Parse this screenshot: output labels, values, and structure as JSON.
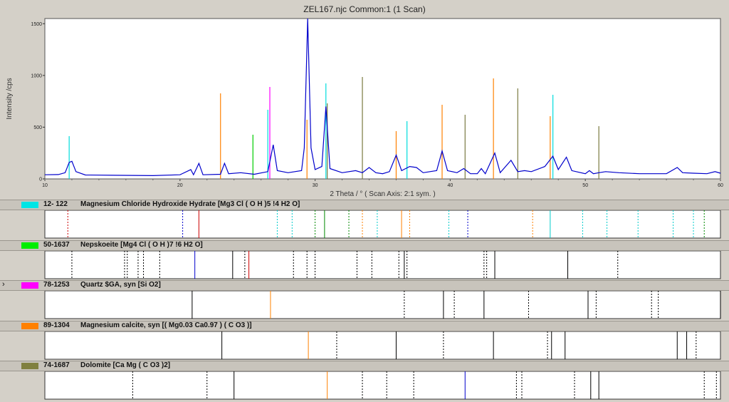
{
  "window": {
    "title": "ZEL167.njc Common:1 (1 Scan)"
  },
  "chart_data": {
    "type": "line",
    "title": "ZEL167.njc Common:1 (1 Scan)",
    "xlabel": "2 Theta / °   ( Scan Axis: 2:1 sym. )",
    "ylabel": "Intensity /cps",
    "xlim": [
      10,
      60
    ],
    "ylim": [
      0,
      1550
    ],
    "x_ticks": [
      10,
      20,
      30,
      40,
      50,
      60
    ],
    "y_ticks": [
      0,
      500,
      1000,
      1500
    ],
    "grid": false,
    "series": [
      {
        "color": "#0000cc",
        "points": [
          [
            10,
            40
          ],
          [
            11,
            42
          ],
          [
            11.5,
            60
          ],
          [
            11.8,
            160
          ],
          [
            12,
            170
          ],
          [
            12.3,
            70
          ],
          [
            13,
            38
          ],
          [
            15,
            35
          ],
          [
            18,
            32
          ],
          [
            20,
            40
          ],
          [
            20.8,
            90
          ],
          [
            21,
            40
          ],
          [
            21.4,
            150
          ],
          [
            21.7,
            40
          ],
          [
            23,
            45
          ],
          [
            23.3,
            150
          ],
          [
            23.6,
            50
          ],
          [
            24.5,
            60
          ],
          [
            25.5,
            45
          ],
          [
            26.5,
            70
          ],
          [
            26.9,
            330
          ],
          [
            27.2,
            80
          ],
          [
            28,
            60
          ],
          [
            29,
            80
          ],
          [
            29.2,
            300
          ],
          [
            29.45,
            1550
          ],
          [
            29.7,
            300
          ],
          [
            30,
            90
          ],
          [
            30.5,
            120
          ],
          [
            30.8,
            700
          ],
          [
            31.1,
            100
          ],
          [
            32,
            60
          ],
          [
            33,
            80
          ],
          [
            33.5,
            60
          ],
          [
            34,
            110
          ],
          [
            34.5,
            60
          ],
          [
            35,
            50
          ],
          [
            35.5,
            70
          ],
          [
            36,
            230
          ],
          [
            36.4,
            80
          ],
          [
            37,
            120
          ],
          [
            37.5,
            110
          ],
          [
            38,
            60
          ],
          [
            39,
            80
          ],
          [
            39.4,
            270
          ],
          [
            39.8,
            80
          ],
          [
            40.5,
            60
          ],
          [
            41,
            100
          ],
          [
            41.5,
            50
          ],
          [
            42,
            50
          ],
          [
            42.3,
            100
          ],
          [
            42.6,
            50
          ],
          [
            43.3,
            250
          ],
          [
            43.7,
            60
          ],
          [
            44.5,
            180
          ],
          [
            45,
            70
          ],
          [
            45.5,
            80
          ],
          [
            46,
            70
          ],
          [
            47,
            120
          ],
          [
            47.6,
            220
          ],
          [
            48,
            90
          ],
          [
            48.6,
            210
          ],
          [
            49,
            80
          ],
          [
            50,
            50
          ],
          [
            50.3,
            80
          ],
          [
            50.6,
            50
          ],
          [
            51,
            60
          ],
          [
            51.5,
            70
          ],
          [
            52.5,
            60
          ],
          [
            54,
            50
          ],
          [
            56,
            50
          ],
          [
            56.8,
            110
          ],
          [
            57.2,
            60
          ],
          [
            58,
            55
          ],
          [
            59,
            50
          ],
          [
            59.6,
            70
          ],
          [
            60,
            55
          ]
        ]
      }
    ],
    "overlay_sticks": [
      {
        "color": "#00dddd",
        "x": [
          11.8,
          26.5,
          30.8,
          36.8,
          47.6
        ]
      },
      {
        "color": "#ff8000",
        "x": [
          29.4,
          23.0,
          36.0,
          39.4,
          43.2,
          47.4
        ]
      },
      {
        "color": "#7a7a40",
        "x": [
          30.9,
          33.5,
          41.1,
          45.0,
          51.0
        ]
      },
      {
        "color": "#ff00ff",
        "x": [
          26.65
        ]
      },
      {
        "color": "#00cc00",
        "x": [
          25.4
        ]
      }
    ]
  },
  "phases": [
    {
      "code": "12- 122",
      "name": "Magnesium Chloride Hydroxide Hydrate  [Mg3 Cl ( O H )5 !4 H2 O]",
      "color": "#00e5e5",
      "selected": false,
      "lines": [
        {
          "x": 11.7,
          "color": "#cc0000",
          "style": "dashed"
        },
        {
          "x": 20.2,
          "color": "#0000cc",
          "style": "dashed"
        },
        {
          "x": 21.4,
          "color": "#cc0000",
          "style": "solid"
        },
        {
          "x": 27.2,
          "color": "#00cccc",
          "style": "dashed"
        },
        {
          "x": 28.3,
          "color": "#00cccc",
          "style": "dashed"
        },
        {
          "x": 30.0,
          "color": "#008800",
          "style": "dashed"
        },
        {
          "x": 30.7,
          "color": "#008800",
          "style": "solid"
        },
        {
          "x": 32.5,
          "color": "#008800",
          "style": "dashed"
        },
        {
          "x": 33.5,
          "color": "#ff8000",
          "style": "dashed"
        },
        {
          "x": 34.6,
          "color": "#00cccc",
          "style": "dashed"
        },
        {
          "x": 36.4,
          "color": "#ff8000",
          "style": "solid"
        },
        {
          "x": 37.0,
          "color": "#ff8000",
          "style": "dashed"
        },
        {
          "x": 39.9,
          "color": "#00cccc",
          "style": "dashed"
        },
        {
          "x": 41.3,
          "color": "#0000cc",
          "style": "dashed"
        },
        {
          "x": 46.1,
          "color": "#ff8000",
          "style": "dashed"
        },
        {
          "x": 47.4,
          "color": "#00cccc",
          "style": "solid"
        },
        {
          "x": 49.8,
          "color": "#00cccc",
          "style": "dashed"
        },
        {
          "x": 51.6,
          "color": "#00cccc",
          "style": "dashed"
        },
        {
          "x": 53.9,
          "color": "#00cccc",
          "style": "dashed"
        },
        {
          "x": 56.5,
          "color": "#00cccc",
          "style": "dashed"
        },
        {
          "x": 58.0,
          "color": "#00cccc",
          "style": "dashed"
        },
        {
          "x": 58.8,
          "color": "#008800",
          "style": "dashed"
        }
      ]
    },
    {
      "code": "50-1637",
      "name": "Nepskoeite  [Mg4 Cl ( O H )7 !6 H2 O]",
      "color": "#00ee00",
      "selected": false,
      "lines": [
        {
          "x": 12.0,
          "color": "#000000",
          "style": "dashed"
        },
        {
          "x": 15.9,
          "color": "#000000",
          "style": "dashed"
        },
        {
          "x": 16.1,
          "color": "#000000",
          "style": "dashed"
        },
        {
          "x": 16.9,
          "color": "#000000",
          "style": "dashed"
        },
        {
          "x": 17.3,
          "color": "#000000",
          "style": "dashed"
        },
        {
          "x": 18.5,
          "color": "#000000",
          "style": "dashed"
        },
        {
          "x": 21.1,
          "color": "#0000cc",
          "style": "solid"
        },
        {
          "x": 23.9,
          "color": "#000000",
          "style": "solid"
        },
        {
          "x": 24.8,
          "color": "#000000",
          "style": "dashed"
        },
        {
          "x": 25.1,
          "color": "#cc0000",
          "style": "solid"
        },
        {
          "x": 28.4,
          "color": "#000000",
          "style": "dashed"
        },
        {
          "x": 29.4,
          "color": "#000000",
          "style": "dashed"
        },
        {
          "x": 30.0,
          "color": "#000000",
          "style": "dashed"
        },
        {
          "x": 33.1,
          "color": "#000000",
          "style": "dashed"
        },
        {
          "x": 34.2,
          "color": "#000000",
          "style": "dashed"
        },
        {
          "x": 36.2,
          "color": "#000000",
          "style": "dashed"
        },
        {
          "x": 36.6,
          "color": "#000000",
          "style": "solid"
        },
        {
          "x": 36.8,
          "color": "#000000",
          "style": "dashed"
        },
        {
          "x": 42.5,
          "color": "#000000",
          "style": "dashed"
        },
        {
          "x": 42.7,
          "color": "#000000",
          "style": "dashed"
        },
        {
          "x": 43.3,
          "color": "#000000",
          "style": "solid"
        },
        {
          "x": 48.7,
          "color": "#000000",
          "style": "solid"
        },
        {
          "x": 52.4,
          "color": "#000000",
          "style": "dashed"
        }
      ]
    },
    {
      "code": "78-1253",
      "name": "Quartz $GA, syn  [Si O2]",
      "color": "#ff00ff",
      "selected": true,
      "lines": [
        {
          "x": 20.9,
          "color": "#000000",
          "style": "solid"
        },
        {
          "x": 26.7,
          "color": "#ff8000",
          "style": "solid"
        },
        {
          "x": 36.6,
          "color": "#000000",
          "style": "dashed"
        },
        {
          "x": 39.5,
          "color": "#000000",
          "style": "solid"
        },
        {
          "x": 40.3,
          "color": "#000000",
          "style": "dashed"
        },
        {
          "x": 42.5,
          "color": "#000000",
          "style": "solid"
        },
        {
          "x": 45.8,
          "color": "#000000",
          "style": "dashed"
        },
        {
          "x": 50.2,
          "color": "#000000",
          "style": "solid"
        },
        {
          "x": 50.8,
          "color": "#000000",
          "style": "dashed"
        },
        {
          "x": 54.9,
          "color": "#000000",
          "style": "dashed"
        },
        {
          "x": 55.4,
          "color": "#000000",
          "style": "dashed"
        },
        {
          "x": 60.0,
          "color": "#000000",
          "style": "solid"
        }
      ]
    },
    {
      "code": "89-1304",
      "name": "Magnesium calcite, syn  [( Mg0.03 Ca0.97 ) ( C O3 )]",
      "color": "#ff8000",
      "selected": false,
      "lines": [
        {
          "x": 23.1,
          "color": "#000000",
          "style": "solid"
        },
        {
          "x": 29.5,
          "color": "#ff8000",
          "style": "solid"
        },
        {
          "x": 31.6,
          "color": "#000000",
          "style": "dashed"
        },
        {
          "x": 36.0,
          "color": "#000000",
          "style": "solid"
        },
        {
          "x": 39.5,
          "color": "#000000",
          "style": "dashed"
        },
        {
          "x": 43.2,
          "color": "#000000",
          "style": "solid"
        },
        {
          "x": 47.2,
          "color": "#000000",
          "style": "dashed"
        },
        {
          "x": 47.5,
          "color": "#000000",
          "style": "solid"
        },
        {
          "x": 48.5,
          "color": "#000000",
          "style": "solid"
        },
        {
          "x": 56.8,
          "color": "#000000",
          "style": "solid"
        },
        {
          "x": 57.5,
          "color": "#000000",
          "style": "solid"
        },
        {
          "x": 58.2,
          "color": "#000000",
          "style": "dashed"
        }
      ]
    },
    {
      "code": "74-1687",
      "name": "Dolomite  [Ca Mg ( C O3 )2]",
      "color": "#808040",
      "selected": false,
      "lines": [
        {
          "x": 16.5,
          "color": "#000000",
          "style": "dashed"
        },
        {
          "x": 22.0,
          "color": "#000000",
          "style": "dashed"
        },
        {
          "x": 24.0,
          "color": "#000000",
          "style": "solid"
        },
        {
          "x": 30.9,
          "color": "#ff8000",
          "style": "solid"
        },
        {
          "x": 33.5,
          "color": "#000000",
          "style": "dashed"
        },
        {
          "x": 35.3,
          "color": "#000000",
          "style": "dashed"
        },
        {
          "x": 37.3,
          "color": "#000000",
          "style": "dashed"
        },
        {
          "x": 41.1,
          "color": "#0000cc",
          "style": "solid"
        },
        {
          "x": 44.9,
          "color": "#000000",
          "style": "dashed"
        },
        {
          "x": 45.3,
          "color": "#000000",
          "style": "dashed"
        },
        {
          "x": 49.2,
          "color": "#000000",
          "style": "dashed"
        },
        {
          "x": 50.4,
          "color": "#000000",
          "style": "solid"
        },
        {
          "x": 51.0,
          "color": "#000000",
          "style": "solid"
        },
        {
          "x": 58.8,
          "color": "#000000",
          "style": "dashed"
        },
        {
          "x": 59.7,
          "color": "#000000",
          "style": "dashed"
        }
      ]
    }
  ]
}
